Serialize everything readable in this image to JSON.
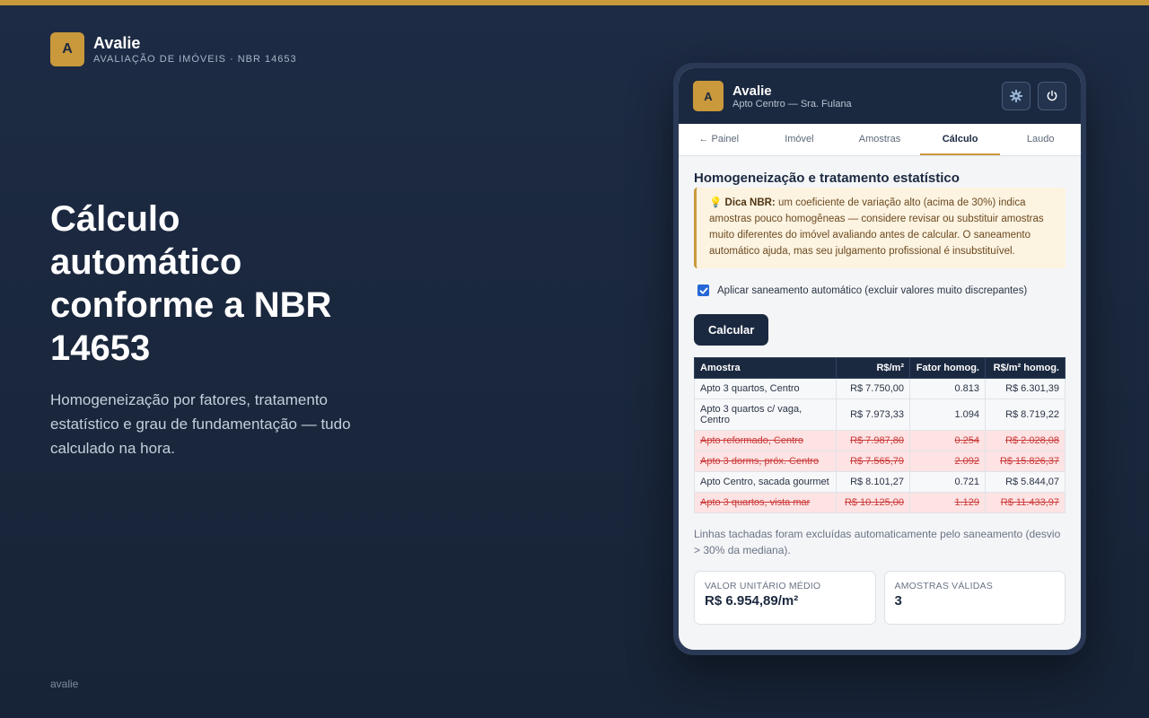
{
  "brand": {
    "logo_letter": "A",
    "name": "Avalie",
    "subtitle": "AVALIAÇÃO DE IMÓVEIS · NBR 14653"
  },
  "hero": {
    "title": "Cálculo automático conforme a NBR 14653",
    "description": "Homogeneização por fatores, tratamento estatístico e grau de fundamentação — tudo calculado na hora."
  },
  "footer": {
    "mark": "avalie"
  },
  "app": {
    "logo_letter": "A",
    "name": "Avalie",
    "subtitle": "Apto Centro — Sra. Fulana",
    "settings_icon": "gear-icon",
    "power_icon": "power-icon"
  },
  "tabs": [
    {
      "label": "← Painel",
      "active": false
    },
    {
      "label": "Imóvel",
      "active": false
    },
    {
      "label": "Amostras",
      "active": false
    },
    {
      "label": "Cálculo",
      "active": true
    },
    {
      "label": "Laudo",
      "active": false
    }
  ],
  "section": {
    "title": "Homogeneização e tratamento estatístico",
    "tip_icon": "💡",
    "tip_label": "Dica NBR:",
    "tip_text": "um coeficiente de variação alto (acima de 30%) indica amostras pouco homogêneas — considere revisar ou substituir amostras muito diferentes do imóvel avaliando antes de calcular. O saneamento automático ajuda, mas seu julgamento profissional é insubstituível.",
    "checkbox_label": "Aplicar saneamento automático (excluir valores muito discrepantes)",
    "checkbox_checked": true,
    "calc_button": "Calcular"
  },
  "table": {
    "headers": [
      "Amostra",
      "R$/m²",
      "Fator homog.",
      "R$/m² homog."
    ],
    "rows": [
      {
        "amostra": "Apto 3 quartos, Centro",
        "rsm2": "R$ 7.750,00",
        "fator": "0.813",
        "homog": "R$ 6.301,39",
        "excluded": false
      },
      {
        "amostra": "Apto 3 quartos c/ vaga, Centro",
        "rsm2": "R$ 7.973,33",
        "fator": "1.094",
        "homog": "R$ 8.719,22",
        "excluded": false
      },
      {
        "amostra": "Apto reformado, Centro",
        "rsm2": "R$ 7.987,80",
        "fator": "0.254",
        "homog": "R$ 2.028,08",
        "excluded": true
      },
      {
        "amostra": "Apto 3 dorms, próx. Centro",
        "rsm2": "R$ 7.565,79",
        "fator": "2.092",
        "homog": "R$ 15.826,37",
        "excluded": true
      },
      {
        "amostra": "Apto Centro, sacada gourmet",
        "rsm2": "R$ 8.101,27",
        "fator": "0.721",
        "homog": "R$ 5.844,07",
        "excluded": false
      },
      {
        "amostra": "Apto 3 quartos, vista mar",
        "rsm2": "R$ 10.125,00",
        "fator": "1.129",
        "homog": "R$ 11.433,97",
        "excluded": true
      }
    ]
  },
  "note": "Linhas tachadas foram excluídas automaticamente pelo saneamento (desvio > 30% da mediana).",
  "stats": {
    "unit_value_label": "VALOR UNITÁRIO MÉDIO",
    "unit_value": "R$ 6.954,89/m²",
    "valid_samples_label": "AMOSTRAS VÁLIDAS",
    "valid_samples": "3"
  },
  "colors": {
    "accent": "#c9993c",
    "navy": "#1b2940",
    "excluded_bg": "#fde3e3",
    "excluded_text": "#cc3a3a"
  }
}
